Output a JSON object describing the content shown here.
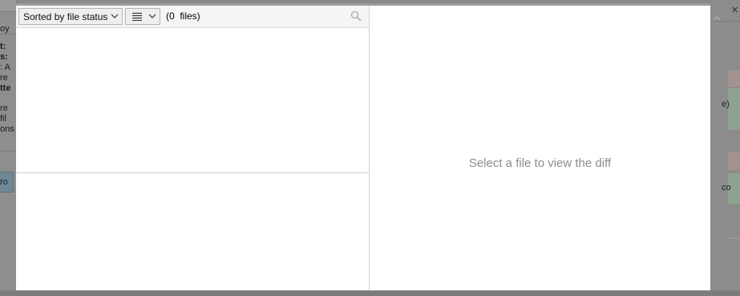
{
  "background": {
    "left_fragments": [
      {
        "text": "oy",
        "bold": false
      },
      {
        "text": "t:",
        "bold": true
      },
      {
        "text": "s:",
        "bold": true
      },
      {
        "text": ": A",
        "bold": false
      },
      {
        "text": "re",
        "bold": false
      },
      {
        "text": "tte",
        "bold": true
      },
      {
        "text": "re",
        "bold": false
      },
      {
        "text": "fil",
        "bold": false
      },
      {
        "text": "ons",
        "bold": false
      }
    ],
    "left_button": "ro",
    "right_fragments": [
      "e)",
      "co"
    ],
    "close_glyph": "✕"
  },
  "toolbar": {
    "sort_label": "Sorted by file status",
    "view_icon": "list-lines-icon",
    "file_count": "(0  files)",
    "search_icon": "search-icon"
  },
  "diff": {
    "placeholder": "Select a file to view the diff"
  },
  "colors": {
    "overlay": "#8a8a8a",
    "dialog_bg": "#ffffff",
    "toolbar_bg": "#f5f5f5",
    "placeholder_text": "#8c8c8c"
  }
}
